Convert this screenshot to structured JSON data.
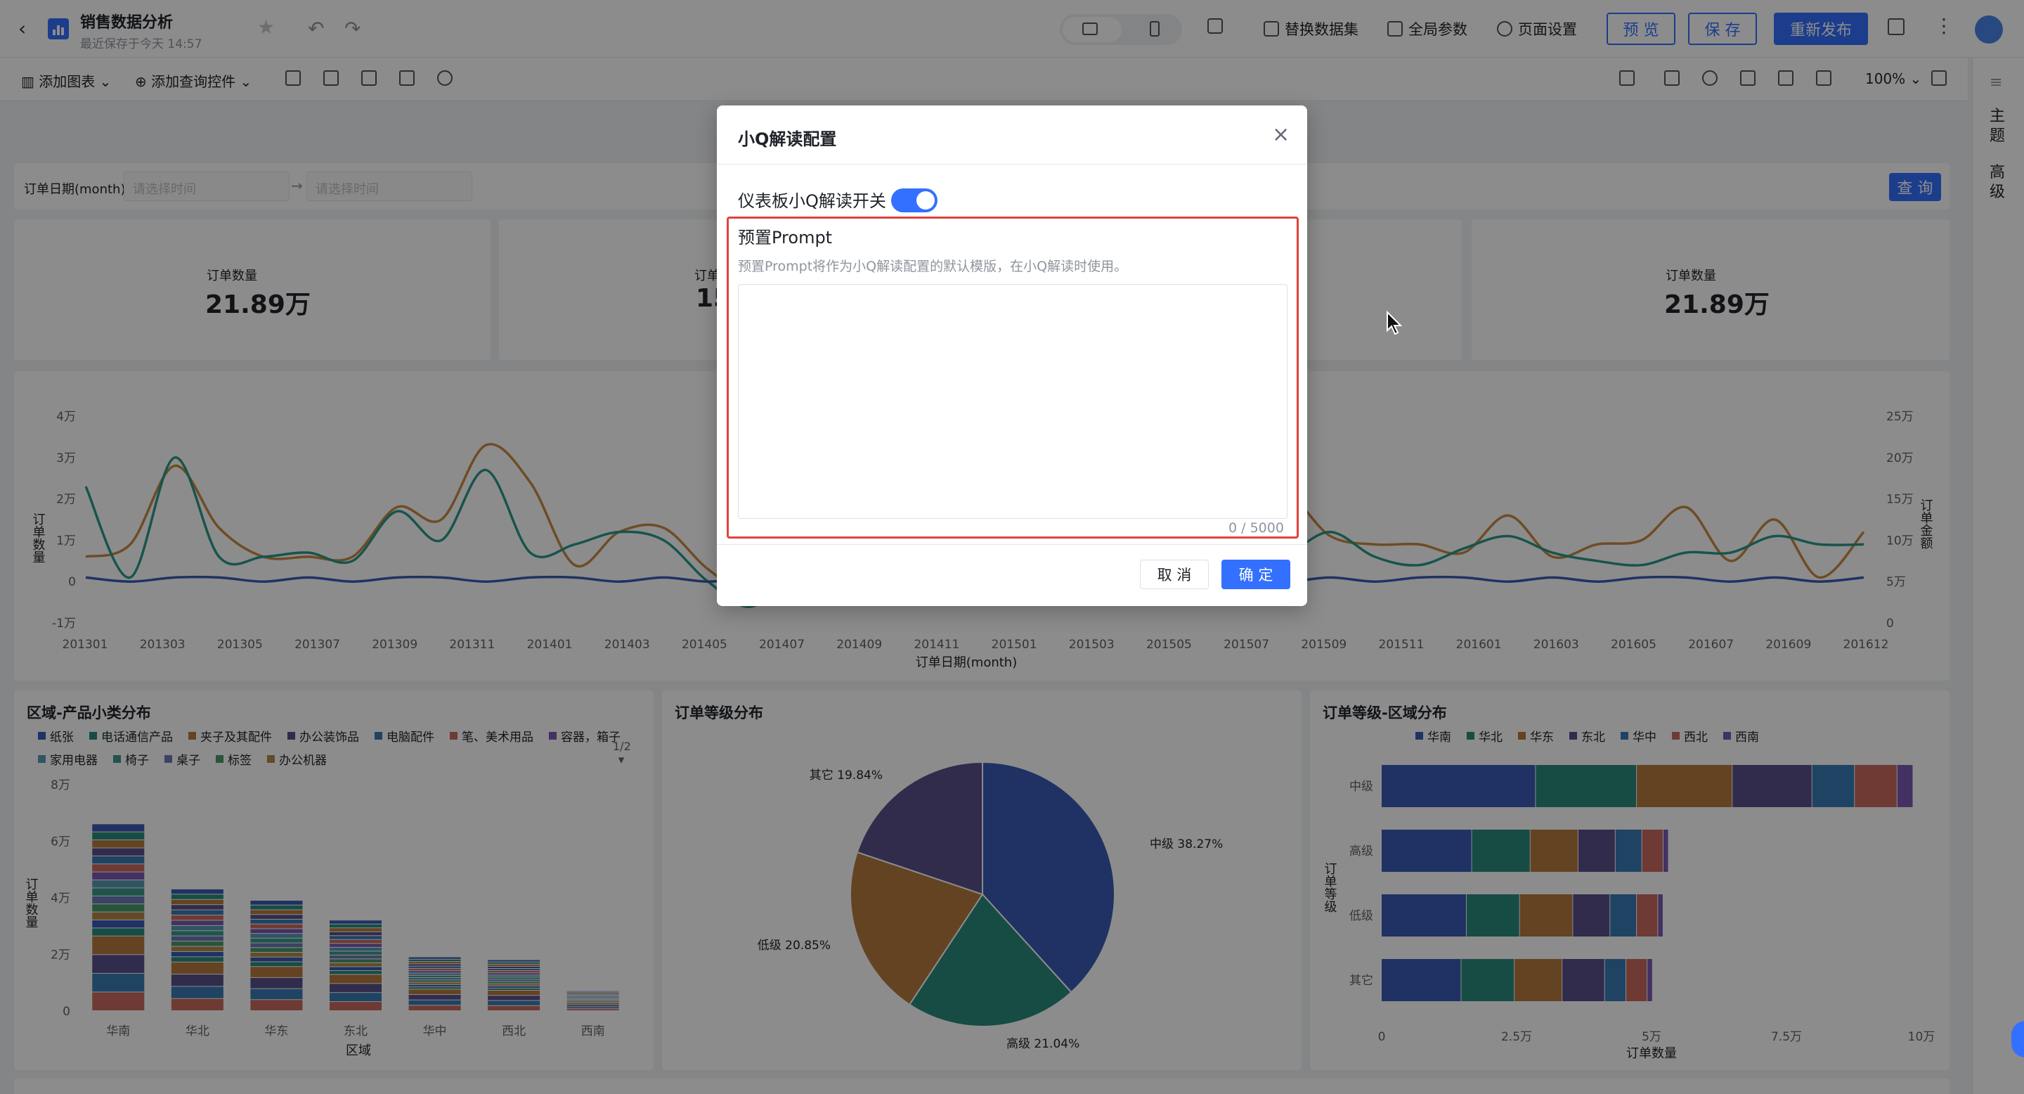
{
  "header": {
    "title": "销售数据分析",
    "saved_time": "最近保存于今天 14:57",
    "replace_dataset": "替换数据集",
    "global_params": "全局参数",
    "page_settings": "页面设置",
    "preview": "预 览",
    "save": "保 存",
    "republish": "重新发布"
  },
  "toolbar": {
    "add_chart": "添加图表",
    "add_query_control": "添加查询控件",
    "zoom": "100%"
  },
  "right_sidebar": {
    "theme": "主题",
    "advanced": "高级"
  },
  "filter": {
    "label": "订单日期(month)",
    "start_placeholder": "请选择时间",
    "end_placeholder": "请选择时间",
    "query_button": "查 询"
  },
  "kpis": [
    {
      "label": "订单数量",
      "value": "21.89万"
    },
    {
      "label": "订单数量",
      "value": "21.89万"
    }
  ],
  "kpi_partial": {
    "label": "订单",
    "value": "15"
  },
  "chart_data": [
    {
      "type": "line",
      "xlabel": "订单日期(month)",
      "ylabel": "订单数量",
      "y2label": "订单金额",
      "y_ticks": [
        "-1万",
        "0",
        "1万",
        "2万",
        "3万",
        "4万"
      ],
      "y2_ticks": [
        "0",
        "5万",
        "10万",
        "15万",
        "20万",
        "25万"
      ],
      "x_ticks": [
        "201301",
        "201303",
        "201305",
        "201307",
        "201309",
        "201311",
        "201401",
        "201403",
        "201405",
        "201407",
        "201409",
        "201411",
        "201501",
        "201503",
        "201505",
        "201507",
        "201509",
        "201511",
        "201601",
        "201603",
        "201605",
        "201607",
        "201609",
        "201612"
      ],
      "ylim": [
        -1,
        4
      ],
      "series": [
        {
          "values": [
            0.6,
            0.9,
            2.8,
            1.3,
            0.6,
            0.6,
            0.6,
            1.8,
            1.5,
            3.3,
            2.4,
            0.4,
            1.2,
            1.3,
            0.3,
            -0.3,
            0.5,
            1.0,
            0.9,
            0.9,
            0.9,
            1.0,
            0.9,
            1.0,
            1.0,
            1.1,
            1.4,
            2.1,
            1.1,
            0.9,
            0.9,
            0.7,
            1.6,
            0.6,
            0.9,
            1.0,
            1.8,
            0.5,
            1.5,
            0.1,
            1.2
          ]
        },
        {
          "values": [
            2.3,
            0.1,
            3.0,
            0.6,
            0.6,
            0.7,
            0.5,
            1.7,
            1.0,
            2.7,
            0.7,
            0.9,
            1.2,
            1.0,
            0.0,
            -0.6,
            0.5,
            1.6,
            0.9,
            0.7,
            0.8,
            0.6,
            0.9,
            0.8,
            0.7,
            0.8,
            0.9,
            0.7,
            1.2,
            0.6,
            0.4,
            0.8,
            1.1,
            0.7,
            0.5,
            0.4,
            0.7,
            0.7,
            1.1,
            0.9,
            0.9
          ]
        },
        {
          "values": [
            0.1,
            0.0,
            0.1,
            0.1,
            0.0,
            0.1,
            0.0,
            0.1,
            0.1,
            0.0,
            0.1,
            0.1,
            0.0,
            0.1,
            0.0,
            0.1,
            0.1,
            0.0,
            0.1,
            0.0,
            0.1,
            0.1,
            0.0,
            0.1,
            0.0,
            0.1,
            0.1,
            0.0,
            0.1,
            0.0,
            0.1,
            0.1,
            0.0,
            0.1,
            0.0,
            0.1,
            0.1,
            0.0,
            0.1,
            0.0,
            0.1
          ]
        }
      ],
      "colors": [
        "#c88a44",
        "#2a9a8a",
        "#3a5bb5"
      ]
    },
    {
      "type": "bar",
      "title": "区域-产品小类分布",
      "xlabel": "区域",
      "ylabel": "订单数量",
      "categories": [
        "华南",
        "华北",
        "华东",
        "东北",
        "华中",
        "西北",
        "西南"
      ],
      "values": [
        6.6,
        4.3,
        3.9,
        3.2,
        1.9,
        1.8,
        0.7
      ],
      "y_ticks": [
        "0",
        "2万",
        "4万",
        "6万",
        "8万"
      ],
      "ylim": [
        0,
        8
      ],
      "legend": [
        "纸张",
        "电话通信产品",
        "夹子及其配件",
        "办公装饰品",
        "电脑配件",
        "笔、美术用品",
        "容器，箱子",
        "家用电器",
        "椅子",
        "桌子",
        "标签",
        "办公机器"
      ],
      "legend_page": "1/2"
    },
    {
      "type": "pie",
      "title": "订单等级分布",
      "slices": [
        {
          "label": "中级 38.27%",
          "value": 38.27,
          "color": "#3a5bb5"
        },
        {
          "label": "高级 21.04%",
          "value": 21.04,
          "color": "#2a8a7e"
        },
        {
          "label": "低级 20.85%",
          "value": 20.85,
          "color": "#b57a3e"
        },
        {
          "label": "其它 19.84%",
          "value": 19.84,
          "color": "#5a4f8a"
        }
      ]
    },
    {
      "type": "bar",
      "title": "订单等级-区域分布",
      "xlabel": "订单数量",
      "ylabel": "订单等级",
      "categories": [
        "中级",
        "高级",
        "低级",
        "其它"
      ],
      "x_ticks": [
        "0",
        "2.5万",
        "5万",
        "7.5万",
        "10万"
      ],
      "xlim": [
        0,
        10
      ],
      "legend": [
        "华南",
        "华北",
        "华东",
        "东北",
        "华中",
        "西北",
        "西南"
      ],
      "colors": [
        "#3a5bb5",
        "#2a8a7e",
        "#b57a3e",
        "#5a4f8a",
        "#3a7ab5",
        "#c86a5e",
        "#7a5ab5"
      ],
      "series": [
        {
          "values": [
            2.9,
            1.7,
            1.6,
            1.5
          ]
        },
        {
          "values": [
            1.9,
            1.1,
            1.0,
            1.0
          ]
        },
        {
          "values": [
            1.8,
            0.9,
            1.0,
            0.9
          ]
        },
        {
          "values": [
            1.5,
            0.7,
            0.7,
            0.8
          ]
        },
        {
          "values": [
            0.8,
            0.5,
            0.5,
            0.4
          ]
        },
        {
          "values": [
            0.8,
            0.4,
            0.4,
            0.4
          ]
        },
        {
          "values": [
            0.3,
            0.1,
            0.1,
            0.1
          ]
        }
      ]
    }
  ],
  "modal": {
    "title": "小Q解读配置",
    "switch_label": "仪表板小Q解读开关",
    "switch_on": true,
    "prompt_title": "预置Prompt",
    "prompt_desc": "预置Prompt将作为小Q解读配置的默认模版，在小Q解读时使用。",
    "prompt_value": "",
    "counter": "0 / 5000",
    "cancel": "取 消",
    "confirm": "确 定"
  }
}
